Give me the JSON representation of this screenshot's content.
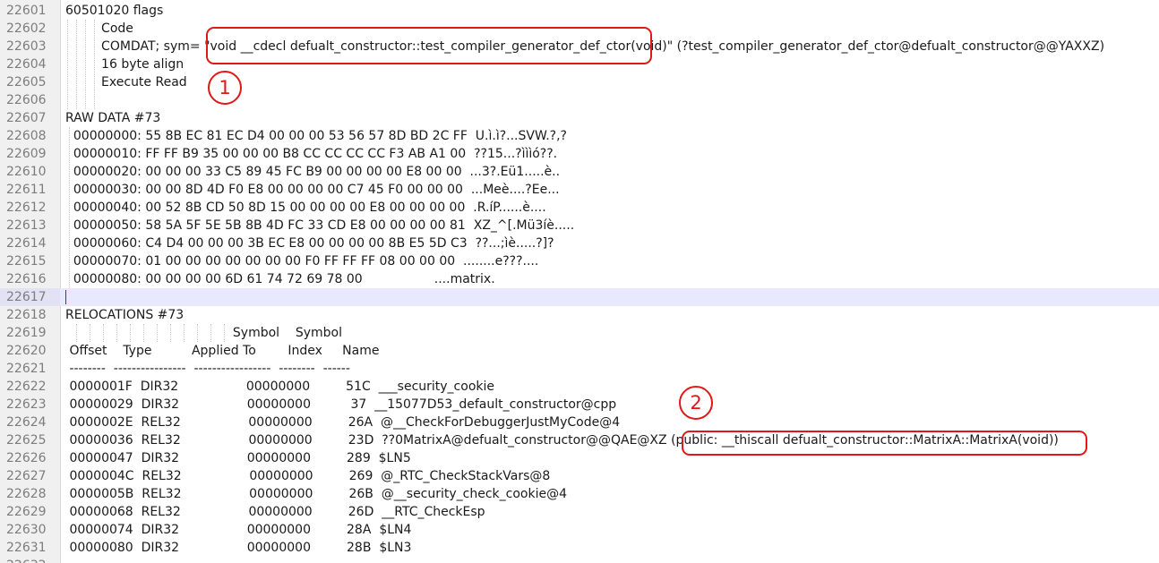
{
  "editor": {
    "lines": [
      {
        "num": "22601",
        "text": "60501020 flags"
      },
      {
        "num": "22602",
        "text": "         Code"
      },
      {
        "num": "22603",
        "text": "         COMDAT; sym= \"void __cdecl defualt_constructor::test_compiler_generator_def_ctor(void)\" (?test_compiler_generator_def_ctor@defualt_constructor@@YAXXZ)"
      },
      {
        "num": "22604",
        "text": "         16 byte align"
      },
      {
        "num": "22605",
        "text": "         Execute Read"
      },
      {
        "num": "22606",
        "text": ""
      },
      {
        "num": "22607",
        "text": "RAW DATA #73"
      },
      {
        "num": "22608",
        "text": "  00000000: 55 8B EC 81 EC D4 00 00 00 53 56 57 8D BD 2C FF  U.ì.ì?...SVW.?,?"
      },
      {
        "num": "22609",
        "text": "  00000010: FF FF B9 35 00 00 00 B8 CC CC CC CC F3 AB A1 00  ??15...?ìììó??."
      },
      {
        "num": "22610",
        "text": "  00000020: 00 00 00 33 C5 89 45 FC B9 00 00 00 00 E8 00 00  ...3?.Eü1.....è.."
      },
      {
        "num": "22611",
        "text": "  00000030: 00 00 8D 4D F0 E8 00 00 00 00 C7 45 F0 00 00 00  ...Meè....?Ee..."
      },
      {
        "num": "22612",
        "text": "  00000040: 00 52 8B CD 50 8D 15 00 00 00 00 E8 00 00 00 00  .R.íP......è...."
      },
      {
        "num": "22613",
        "text": "  00000050: 58 5A 5F 5E 5B 8B 4D FC 33 CD E8 00 00 00 00 81  XZ_^[.Mü3íè....."
      },
      {
        "num": "22614",
        "text": "  00000060: C4 D4 00 00 00 3B EC E8 00 00 00 00 8B E5 5D C3  ??...;ìè.....?]?"
      },
      {
        "num": "22615",
        "text": "  00000070: 01 00 00 00 00 00 00 00 F0 FF FF FF 08 00 00 00  ........e???...."
      },
      {
        "num": "22616",
        "text": "  00000080: 00 00 00 00 6D 61 74 72 69 78 00                  ....matrix."
      },
      {
        "num": "22617",
        "text": "",
        "current": true
      },
      {
        "num": "22618",
        "text": "RELOCATIONS #73"
      },
      {
        "num": "22619",
        "text": "                                          Symbol    Symbol"
      },
      {
        "num": "22620",
        "text": " Offset    Type          Applied To        Index     Name"
      },
      {
        "num": "22621",
        "text": " --------  ----------------  -----------------  --------  ------"
      },
      {
        "num": "22622",
        "text": " 0000001F  DIR32                 00000000         51C  ___security_cookie"
      },
      {
        "num": "22623",
        "text": " 00000029  DIR32                 00000000          37  __15077D53_default_constructor@cpp"
      },
      {
        "num": "22624",
        "text": " 0000002E  REL32                 00000000         26A  @__CheckForDebuggerJustMyCode@4"
      },
      {
        "num": "22625",
        "text": " 00000036  REL32                 00000000         23D  ??0MatrixA@defualt_constructor@@QAE@XZ (public: __thiscall defualt_constructor::MatrixA::MatrixA(void))"
      },
      {
        "num": "22626",
        "text": " 00000047  DIR32                 00000000         289  $LN5"
      },
      {
        "num": "22627",
        "text": " 0000004C  REL32                 00000000         269  @_RTC_CheckStackVars@8"
      },
      {
        "num": "22628",
        "text": " 0000005B  REL32                 00000000         26B  @__security_check_cookie@4"
      },
      {
        "num": "22629",
        "text": " 00000068  REL32                 00000000         26D  __RTC_CheckEsp"
      },
      {
        "num": "22630",
        "text": " 00000074  DIR32                 00000000         28A  $LN4"
      },
      {
        "num": "22631",
        "text": " 00000080  DIR32                 00000000         28B  $LN3"
      },
      {
        "num": "22632",
        "text": ""
      }
    ]
  },
  "annotations": {
    "marker_1": "1",
    "marker_2": "2",
    "highlight_color": "#e01818"
  }
}
